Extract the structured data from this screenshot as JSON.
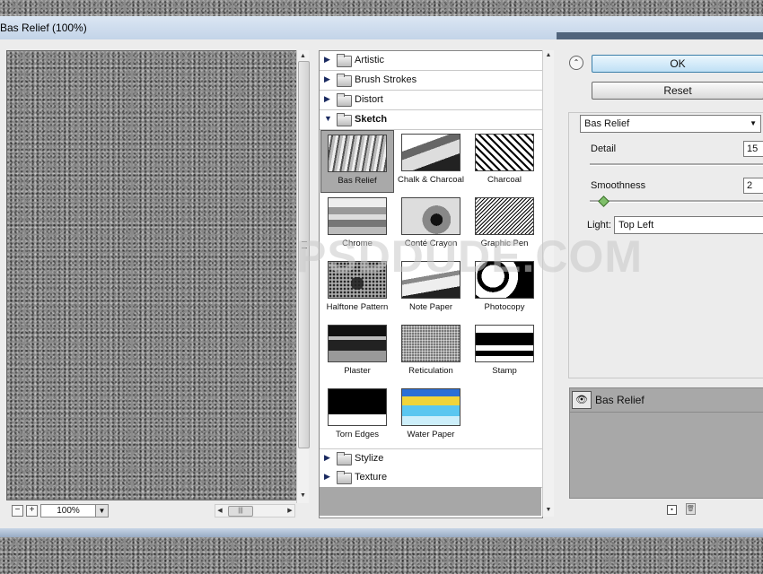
{
  "window": {
    "title": "Bas Relief (100%)"
  },
  "preview": {
    "zoom": "100%"
  },
  "gallery": {
    "categories_top": [
      {
        "label": "Artistic",
        "open": false
      },
      {
        "label": "Brush Strokes",
        "open": false
      },
      {
        "label": "Distort",
        "open": false
      },
      {
        "label": "Sketch",
        "open": true
      }
    ],
    "filters": [
      {
        "label": "Bas Relief",
        "selected": true
      },
      {
        "label": "Chalk & Charcoal"
      },
      {
        "label": "Charcoal"
      },
      {
        "label": "Chrome"
      },
      {
        "label": "Conté Crayon"
      },
      {
        "label": "Graphic Pen"
      },
      {
        "label": "Halftone Pattern"
      },
      {
        "label": "Note Paper"
      },
      {
        "label": "Photocopy"
      },
      {
        "label": "Plaster"
      },
      {
        "label": "Reticulation"
      },
      {
        "label": "Stamp"
      },
      {
        "label": "Torn Edges"
      },
      {
        "label": "Water Paper"
      }
    ],
    "categories_bottom": [
      {
        "label": "Stylize"
      },
      {
        "label": "Texture"
      }
    ]
  },
  "buttons": {
    "ok": "OK",
    "reset": "Reset"
  },
  "settings": {
    "filter_select": "Bas Relief",
    "detail_label": "Detail",
    "detail_value": "15",
    "smoothness_label": "Smoothness",
    "smoothness_value": "2",
    "light_label": "Light:",
    "light_value": "Top Left"
  },
  "layers": {
    "items": [
      {
        "label": "Bas Relief"
      }
    ]
  },
  "watermark": "PSDDUDE.COM"
}
